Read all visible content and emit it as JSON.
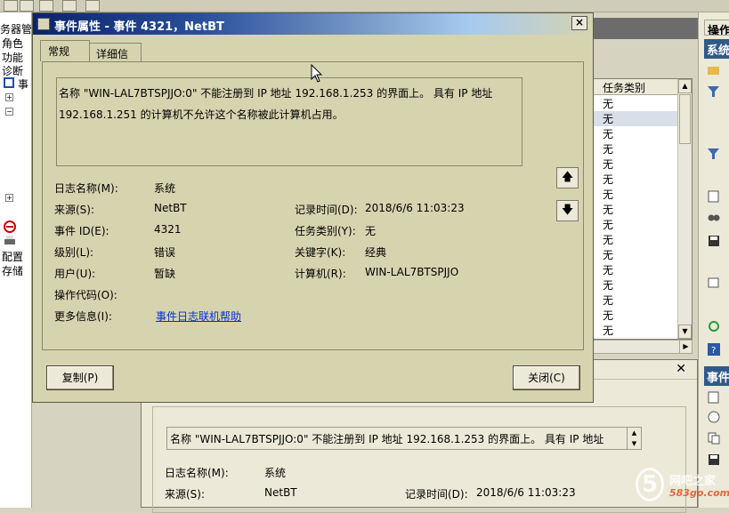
{
  "background": {
    "tree_items": [
      "务器管",
      "角色",
      "功能",
      "诊断",
      "事",
      "配置",
      "存储"
    ],
    "list_header": "任务类别",
    "list_rows": [
      "无",
      "无",
      "无",
      "无",
      "无",
      "无",
      "无",
      "无",
      "无",
      "无",
      "无",
      "无",
      "无",
      "无",
      "无",
      "无"
    ],
    "right_panel_title": "操作",
    "right_panel_section1": "系统",
    "right_panel_section2": "事件",
    "lower": {
      "message": "名称 \"WIN-LAL7BTSPJJO:0\" 不能注册到 IP 地址 192.168.1.253 的界面上。 具有 IP 地址",
      "log_name_label": "日志名称(M):",
      "log_name_value": "系统",
      "source_label": "来源(S):",
      "source_value": "NetBT",
      "logged_label": "记录时间(D):",
      "logged_value": "2018/6/6 11:03:23"
    },
    "watermark": {
      "glyph": "5",
      "text": "网吧之家",
      "sub": "583go.com"
    }
  },
  "dialog": {
    "title": "事件属性 - 事件 4321，NetBT",
    "close_glyph": "×",
    "tabs": [
      {
        "label": "常规",
        "active": true
      },
      {
        "label": "详细信息",
        "active": false
      }
    ],
    "message_line1": "名称 \"WIN-LAL7BTSPJJO:0\" 不能注册到 IP 地址 192.168.1.253 的界面上。 具有 IP 地址",
    "message_line2": "192.168.1.251 的计算机不允许这个名称被此计算机占用。",
    "fields": {
      "log_name": {
        "label": "日志名称(M):",
        "value": "系统"
      },
      "source": {
        "label": "来源(S):",
        "value": "NetBT"
      },
      "logged": {
        "label": "记录时间(D):",
        "value": "2018/6/6 11:03:23"
      },
      "event_id": {
        "label": "事件 ID(E):",
        "value": "4321"
      },
      "task_category": {
        "label": "任务类别(Y):",
        "value": "无"
      },
      "level": {
        "label": "级别(L):",
        "value": "错误"
      },
      "keywords": {
        "label": "关键字(K):",
        "value": "经典"
      },
      "user": {
        "label": "用户(U):",
        "value": "暂缺"
      },
      "computer": {
        "label": "计算机(R):",
        "value": "WIN-LAL7BTSPJJO"
      },
      "opcode": {
        "label": "操作代码(O):",
        "value": ""
      },
      "more_info": {
        "label": "更多信息(I):",
        "value": "事件日志联机帮助"
      }
    },
    "copy_button": "复制(P)",
    "close_button": "关闭(C)",
    "up_arrow": "🡅",
    "down_arrow": "🡇"
  }
}
